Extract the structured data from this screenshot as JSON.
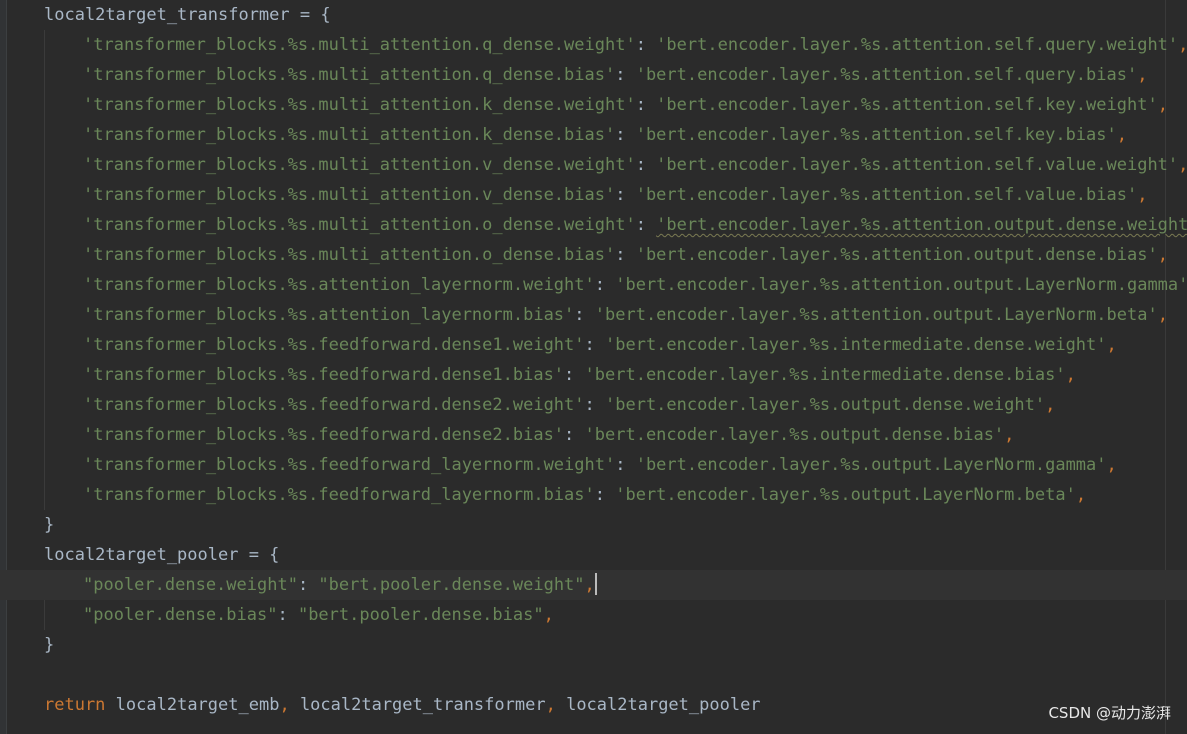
{
  "editor": {
    "transformer_header": "local2target_transformer = {",
    "transformer_entries": [
      {
        "key": "'transformer_blocks.%s.multi_attention.q_dense.weight'",
        "value": "'bert.encoder.layer.%s.attention.self.query.weight'"
      },
      {
        "key": "'transformer_blocks.%s.multi_attention.q_dense.bias'",
        "value": "'bert.encoder.layer.%s.attention.self.query.bias'"
      },
      {
        "key": "'transformer_blocks.%s.multi_attention.k_dense.weight'",
        "value": "'bert.encoder.layer.%s.attention.self.key.weight'"
      },
      {
        "key": "'transformer_blocks.%s.multi_attention.k_dense.bias'",
        "value": "'bert.encoder.layer.%s.attention.self.key.bias'"
      },
      {
        "key": "'transformer_blocks.%s.multi_attention.v_dense.weight'",
        "value": "'bert.encoder.layer.%s.attention.self.value.weight'"
      },
      {
        "key": "'transformer_blocks.%s.multi_attention.v_dense.bias'",
        "value": "'bert.encoder.layer.%s.attention.self.value.bias'"
      },
      {
        "key": "'transformer_blocks.%s.multi_attention.o_dense.weight'",
        "value": "'bert.encoder.layer.%s.attention.output.dense.weight'"
      },
      {
        "key": "'transformer_blocks.%s.multi_attention.o_dense.bias'",
        "value": "'bert.encoder.layer.%s.attention.output.dense.bias'"
      },
      {
        "key": "'transformer_blocks.%s.attention_layernorm.weight'",
        "value": "'bert.encoder.layer.%s.attention.output.LayerNorm.gamma'"
      },
      {
        "key": "'transformer_blocks.%s.attention_layernorm.bias'",
        "value": "'bert.encoder.layer.%s.attention.output.LayerNorm.beta'"
      },
      {
        "key": "'transformer_blocks.%s.feedforward.dense1.weight'",
        "value": "'bert.encoder.layer.%s.intermediate.dense.weight'"
      },
      {
        "key": "'transformer_blocks.%s.feedforward.dense1.bias'",
        "value": "'bert.encoder.layer.%s.intermediate.dense.bias'"
      },
      {
        "key": "'transformer_blocks.%s.feedforward.dense2.weight'",
        "value": "'bert.encoder.layer.%s.output.dense.weight'"
      },
      {
        "key": "'transformer_blocks.%s.feedforward.dense2.bias'",
        "value": "'bert.encoder.layer.%s.output.dense.bias'"
      },
      {
        "key": "'transformer_blocks.%s.feedforward_layernorm.weight'",
        "value": "'bert.encoder.layer.%s.output.LayerNorm.gamma'"
      },
      {
        "key": "'transformer_blocks.%s.feedforward_layernorm.bias'",
        "value": "'bert.encoder.layer.%s.output.LayerNorm.beta'"
      }
    ],
    "close_brace": "}",
    "pooler_header": "local2target_pooler = {",
    "pooler_entries": [
      {
        "key": "\"pooler.dense.weight\"",
        "value": "\"bert.pooler.dense.weight\""
      },
      {
        "key": "\"pooler.dense.bias\"",
        "value": "\"bert.pooler.dense.bias\""
      }
    ],
    "return_keyword": "return",
    "return_values": [
      "local2target_emb",
      "local2target_transformer",
      "local2target_pooler"
    ],
    "separator": ": ",
    "comma": ",",
    "current_line_index": 0
  },
  "watermark": "CSDN @动力澎湃",
  "colors": {
    "background": "#2b2b2b",
    "identifier": "#a9b7c6",
    "string": "#6a8759",
    "keyword": "#cc7832",
    "current_line": "#323232"
  }
}
